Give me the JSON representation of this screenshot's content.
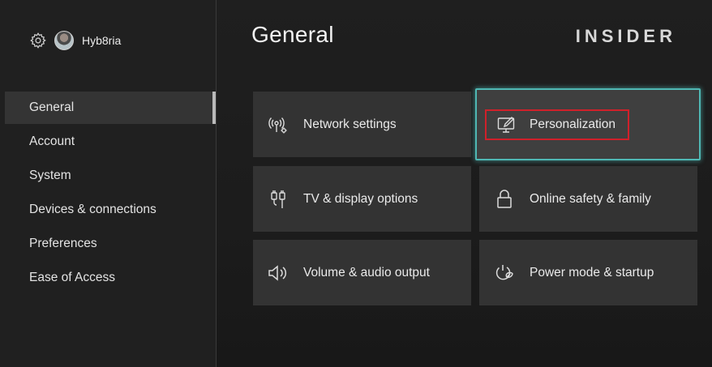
{
  "profile": {
    "username": "Hyb8ria"
  },
  "header": {
    "title": "General",
    "brand": "INSIDER"
  },
  "sidebar": {
    "items": [
      {
        "label": "General",
        "active": true
      },
      {
        "label": "Account"
      },
      {
        "label": "System"
      },
      {
        "label": "Devices & connections"
      },
      {
        "label": "Preferences"
      },
      {
        "label": "Ease of Access"
      }
    ]
  },
  "tiles": [
    {
      "label": "Network settings",
      "icon": "network-icon"
    },
    {
      "label": "Personalization",
      "icon": "personalization-icon",
      "focused": true
    },
    {
      "label": "TV & display options",
      "icon": "tv-display-icon"
    },
    {
      "label": "Online safety & family",
      "icon": "lock-icon"
    },
    {
      "label": "Volume & audio output",
      "icon": "speaker-icon"
    },
    {
      "label": "Power mode & startup",
      "icon": "power-icon"
    }
  ],
  "colors": {
    "focus": "#4fb8b4",
    "annotation": "#d0202a",
    "tile": "#333333"
  }
}
